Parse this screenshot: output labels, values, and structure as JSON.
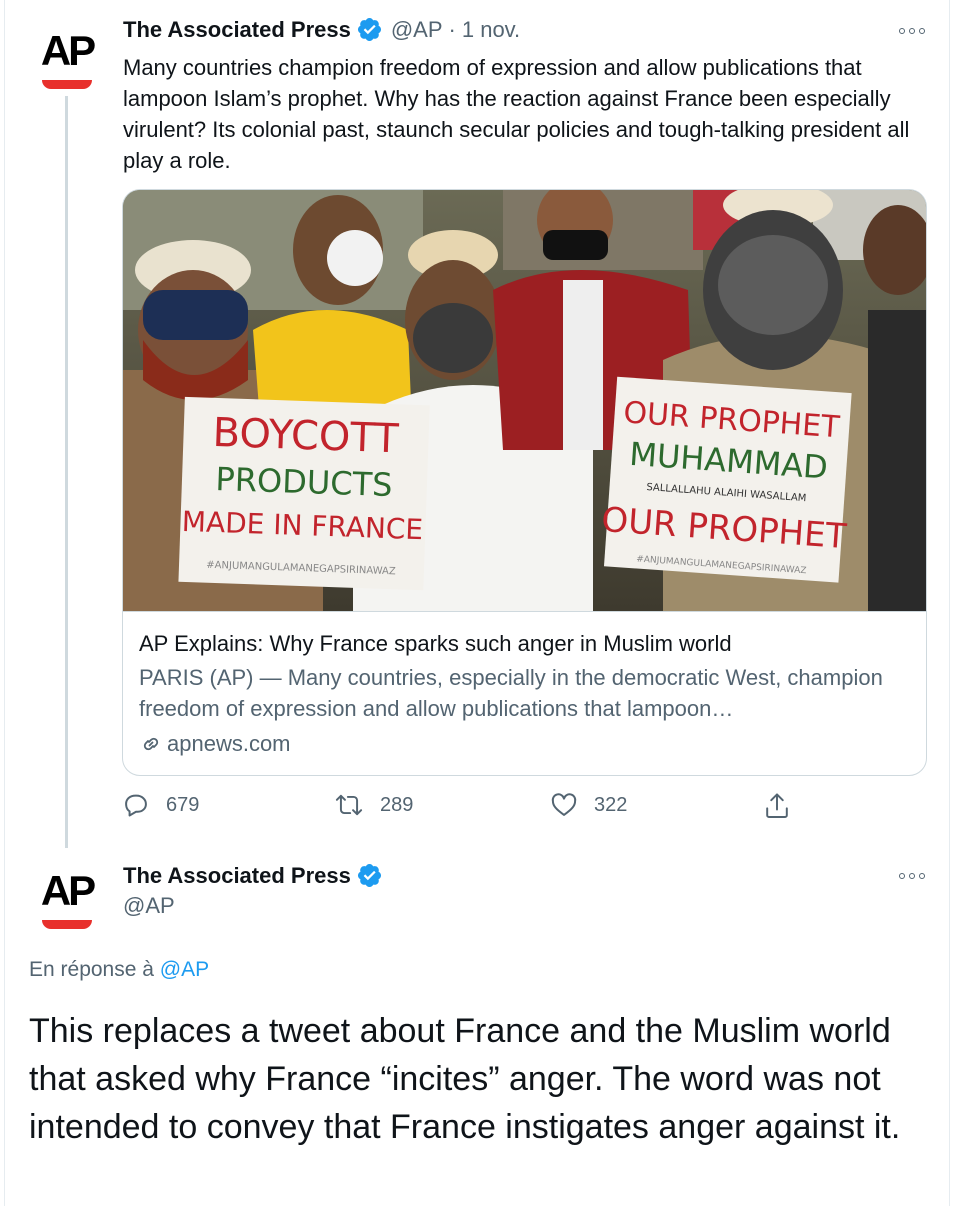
{
  "tweet1": {
    "display_name": "The Associated Press",
    "handle": "@AP",
    "separator": "·",
    "time": "1 nov.",
    "text": "Many countries champion freedom of expression and allow publications that lampoon Islam’s prophet. Why has the reaction against France been especially virulent? Its colonial past, staunch secular policies and tough-talking president all play a role.",
    "card": {
      "title": "AP Explains: Why France sparks such anger in Muslim world",
      "description": "PARIS (AP) — Many countries, especially in the democratic West, champion freedom of expression and allow publications that lampoon…",
      "domain": "apnews.com",
      "sign_left": [
        "BOYCOTT",
        "PRODUCTS",
        "MADE IN FRANCE",
        "#ANJUMANGULAMANEGAPSIRINAWAZ"
      ],
      "sign_right": [
        "OUR PROPHET",
        "MUHAMMAD",
        "SALLALLAHU ALAIHI WASALLAM",
        "OUR PROPHET",
        "#ANJUMANGULAMANEGAPSIRINAWAZ"
      ]
    },
    "actions": {
      "replies": "679",
      "retweets": "289",
      "likes": "322"
    }
  },
  "tweet2": {
    "display_name": "The Associated Press",
    "handle": "@AP",
    "reply_prefix": "En réponse à",
    "reply_handle": "@AP",
    "text": "This replaces a tweet about France and the Muslim world that asked why France “incites” anger. The word was not intended to convey that France instigates anger against it."
  },
  "avatar_text": "AP",
  "colors": {
    "accent": "#1d9bf0",
    "secondary_text": "#536471",
    "ap_red": "#e8302c",
    "border": "#cfd9de"
  }
}
